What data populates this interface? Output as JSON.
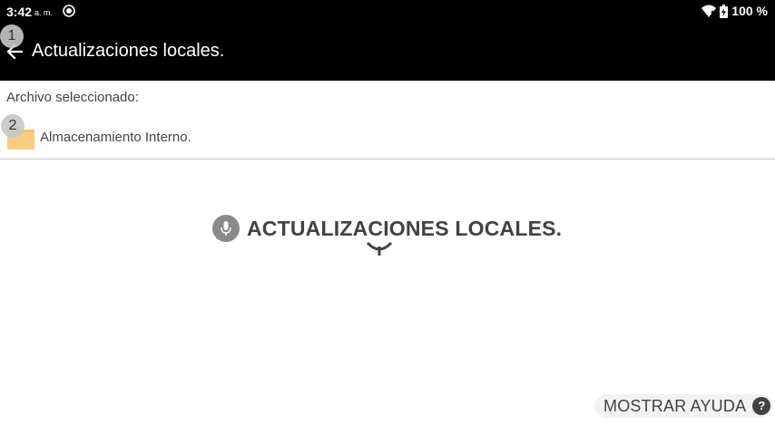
{
  "status_bar": {
    "time": "3:42",
    "ampm": "a. m.",
    "battery": "100 %"
  },
  "header": {
    "title": "Actualizaciones locales."
  },
  "file_selection": {
    "label": "Archivo seleccionado:",
    "storage_name": "Almacenamiento Interno."
  },
  "main": {
    "heading": "ACTUALIZACIONES LOCALES."
  },
  "help": {
    "label": "MOSTRAR AYUDA",
    "icon_glyph": "?"
  },
  "markers": [
    "1",
    "2"
  ],
  "colors": {
    "topbar": "#000000",
    "folder": "#f5bf6a",
    "mic_circle": "#8a8a8a",
    "divider": "#c8c8c8"
  },
  "icons": {
    "back": "arrow-left-icon",
    "app": "target-icon",
    "wifi": "wifi-icon",
    "battery": "battery-icon",
    "folder": "folder-icon",
    "mic": "microphone-icon",
    "help": "question-icon"
  }
}
